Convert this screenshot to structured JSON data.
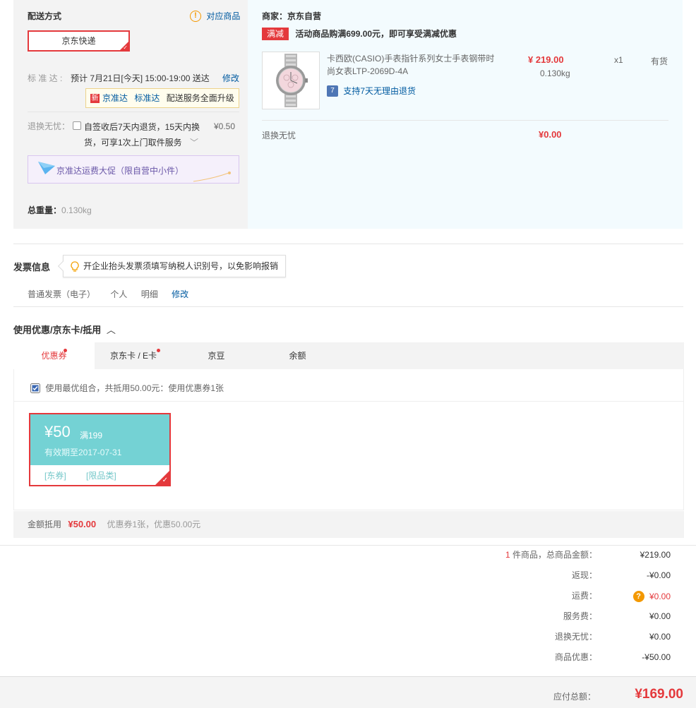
{
  "delivery": {
    "title": "配送方式",
    "matching_goods_link": "对应商品",
    "option_selected": "京东快递",
    "standard_label": "标 准 达 :",
    "standard_time": "预计 7月21日[今天] 15:00-19:00 送达",
    "modify": "修改",
    "upgrade": {
      "badge": "新",
      "link1": "京准达",
      "link2": "标准达",
      "text": "配送服务全面升级"
    },
    "return_label": "退换无忧：",
    "return_option_line1": "自签收后7天内退货，15天内换",
    "return_option_line2": "货，可享1次上门取件服务",
    "return_price": "¥0.50",
    "promo_text": "京准达运费大促（限自营中小件）",
    "total_weight_label": "总重量：",
    "total_weight_value": "0.130kg"
  },
  "seller": {
    "label": "商家：京东自营",
    "tag": "满减",
    "promo": "活动商品购满699.00元，即可享受满减优惠",
    "product": {
      "name_line1": "卡西欧(CASIO)手表指针系列女士手表钢带时",
      "name_line2": "尚女表LTP-2069D-4A",
      "price": "¥ 219.00",
      "weight": "0.130kg",
      "qty": "x1",
      "stock": "有货",
      "return_note": "支持7天无理由退货",
      "return_icon": "7"
    },
    "return_row_label": "退换无忧",
    "return_row_value": "¥0.00"
  },
  "invoice": {
    "title": "发票信息",
    "tip": "开企业抬头发票须填写纳税人识别号，以免影响报销",
    "type": "普通发票（电子）",
    "owner": "个人",
    "content": "明细",
    "modify": "修改"
  },
  "discount": {
    "title": "使用优惠/京东卡/抵用",
    "tabs": [
      {
        "label": "优惠券"
      },
      {
        "label": "京东卡 / E卡"
      },
      {
        "label": "京豆"
      },
      {
        "label": "余额"
      }
    ],
    "best_combo": "使用最优组合，共抵用50.00元：使用优惠券1张",
    "coupon": {
      "amount": "¥50",
      "condition": "满199",
      "expiry": "有效期至2017-07-31",
      "tag1": "[东券]",
      "tag2": "[限品类]"
    },
    "footer_label": "金额抵用",
    "footer_amount": "¥50.00",
    "footer_note": "优惠券1张，优惠50.00元"
  },
  "summary": {
    "count": "1",
    "count_label": "件商品，总商品金额：",
    "goods_total": "¥219.00",
    "rows": [
      {
        "label": "返现：",
        "value": "-¥0.00"
      },
      {
        "label": "运费：",
        "value": "¥0.00"
      },
      {
        "label": "服务费：",
        "value": "¥0.00"
      },
      {
        "label": "退换无忧：",
        "value": "¥0.00"
      },
      {
        "label": "商品优惠：",
        "value": "-¥50.00"
      }
    ],
    "total_label": "应付总额：",
    "total_value": "¥169.00"
  },
  "colors": {
    "accent": "#e4393c",
    "link": "#005aa0",
    "coupon": "#74d2d4"
  }
}
